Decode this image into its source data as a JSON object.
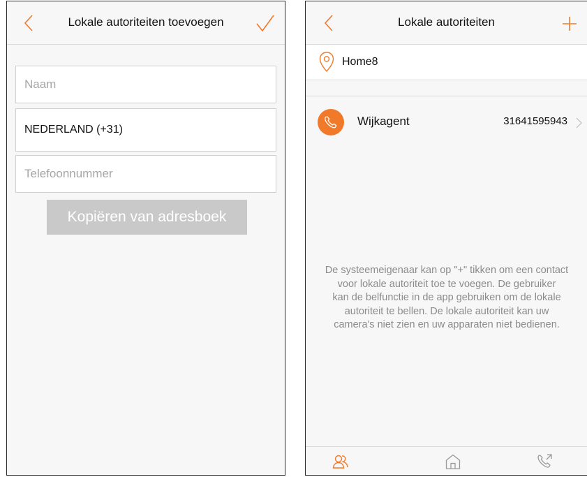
{
  "colors": {
    "accent": "#f07a2a",
    "disabled_button": "#c9c9c9",
    "hint_text": "#8b8b8b"
  },
  "left_screen": {
    "title": "Lokale autoriteiten toevoegen",
    "back_icon": "chevron-left-icon",
    "confirm_icon": "checkmark-icon",
    "name_field": {
      "placeholder": "Naam",
      "value": ""
    },
    "country": "NEDERLAND (+31)",
    "phone_field": {
      "placeholder": "Telefoonnummer",
      "value": ""
    },
    "copy_button": "Kopiëren van adresboek"
  },
  "right_screen": {
    "title": "Lokale autoriteiten",
    "back_icon": "chevron-left-icon",
    "add_icon": "plus-icon",
    "home": {
      "icon": "location-pin-icon",
      "label": "Home8"
    },
    "contact": {
      "icon": "phone-icon",
      "name": "Wijkagent",
      "number": "31641595943"
    },
    "hint_lines": [
      "De systeemeigenaar kan op \"+\" tikken om een contact",
      "voor lokale autoriteit toe te voegen. De gebruiker",
      "kan de belfunctie in de app gebruiken om de lokale",
      "autoriteit te bellen. De lokale autoriteit kan uw",
      "camera's niet zien en uw apparaten niet bedienen."
    ],
    "tabs": [
      {
        "icon": "contacts-icon",
        "active": true
      },
      {
        "icon": "home-icon",
        "active": false
      },
      {
        "icon": "phone-call-icon",
        "active": false
      }
    ]
  }
}
